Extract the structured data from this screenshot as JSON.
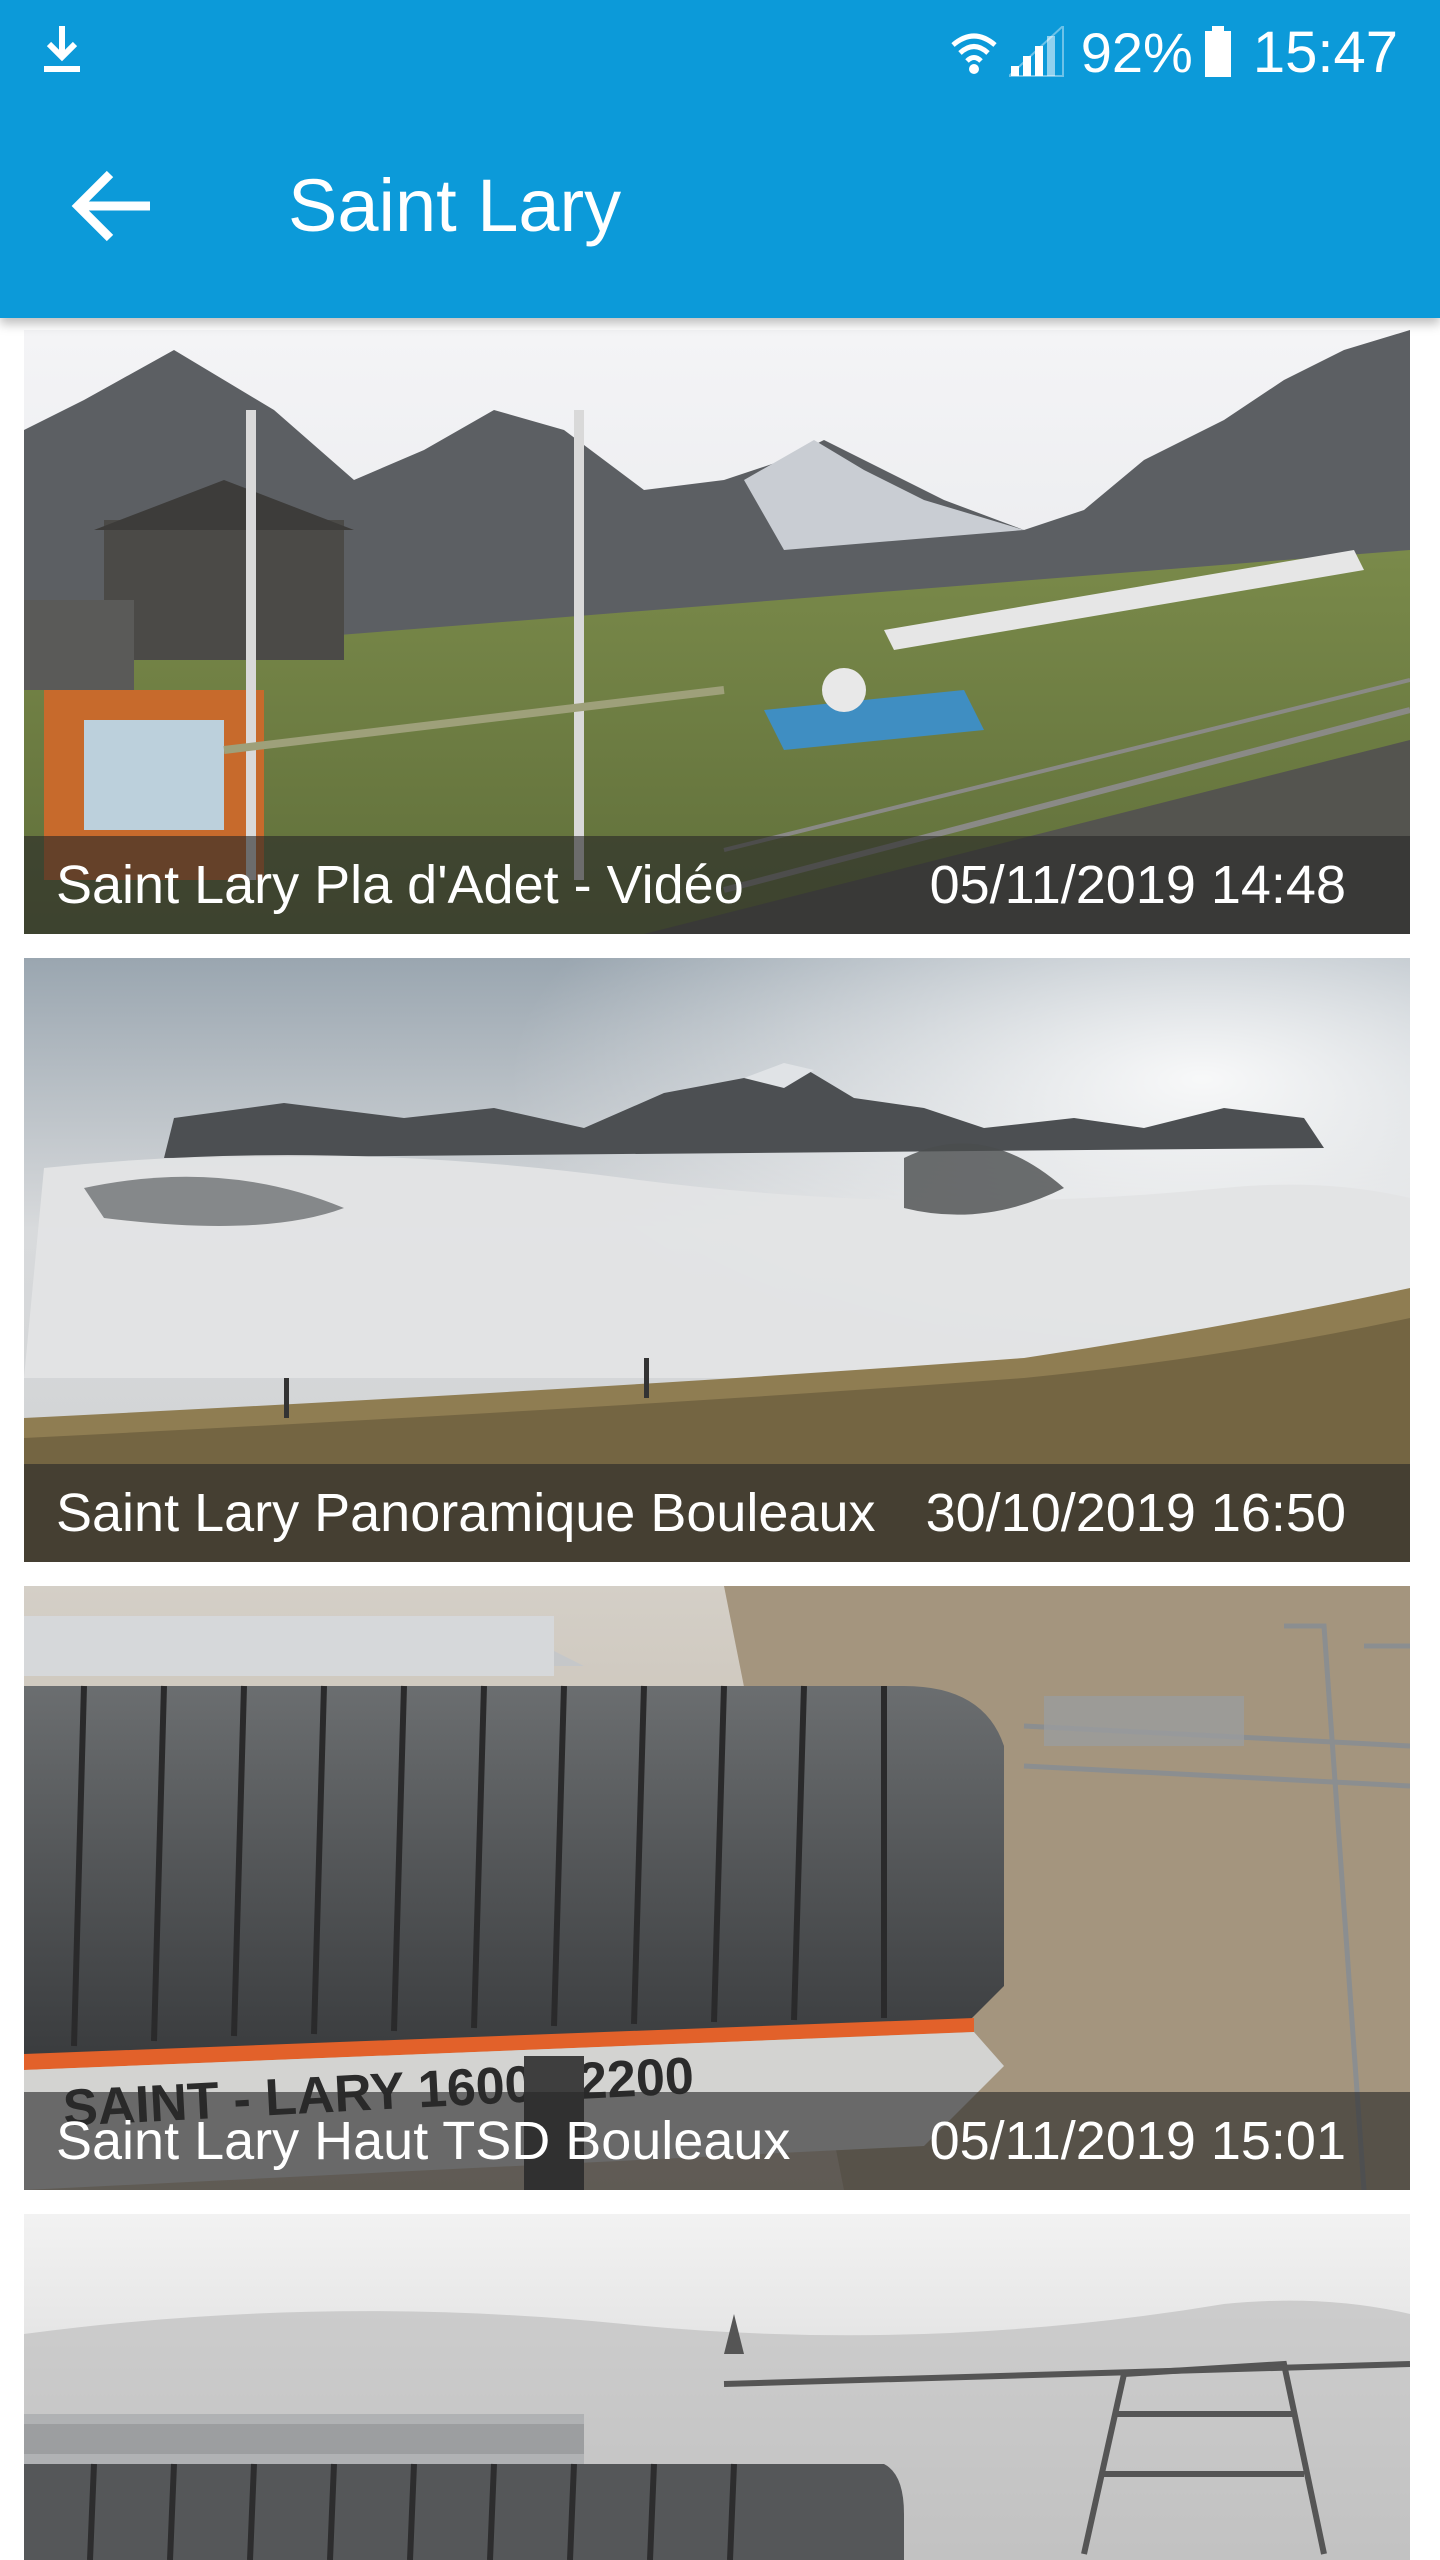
{
  "status_bar": {
    "download_icon": "download-icon",
    "wifi_icon": "wifi-icon",
    "signal_icon": "signal-icon",
    "battery_percent": "92%",
    "battery_icon": "battery-icon",
    "time": "15:47"
  },
  "app_bar": {
    "back_icon": "arrow-back-icon",
    "title": "Saint Lary"
  },
  "colors": {
    "app_bar": "#0c9ad9",
    "caption_overlay": "rgba(40,40,40,0.62)"
  },
  "webcams": [
    {
      "name": "Saint Lary Pla d'Adet - Vidéo",
      "timestamp": "05/11/2019 14:48"
    },
    {
      "name": "Saint Lary Panoramique Bouleaux",
      "timestamp": "30/10/2019 16:50"
    },
    {
      "name": "Saint Lary Haut TSD Bouleaux",
      "timestamp": "05/11/2019 15:01"
    },
    {
      "name": "",
      "timestamp": ""
    }
  ],
  "signage": {
    "lift_station_text": "SAINT - LARY 1600 >2200"
  }
}
